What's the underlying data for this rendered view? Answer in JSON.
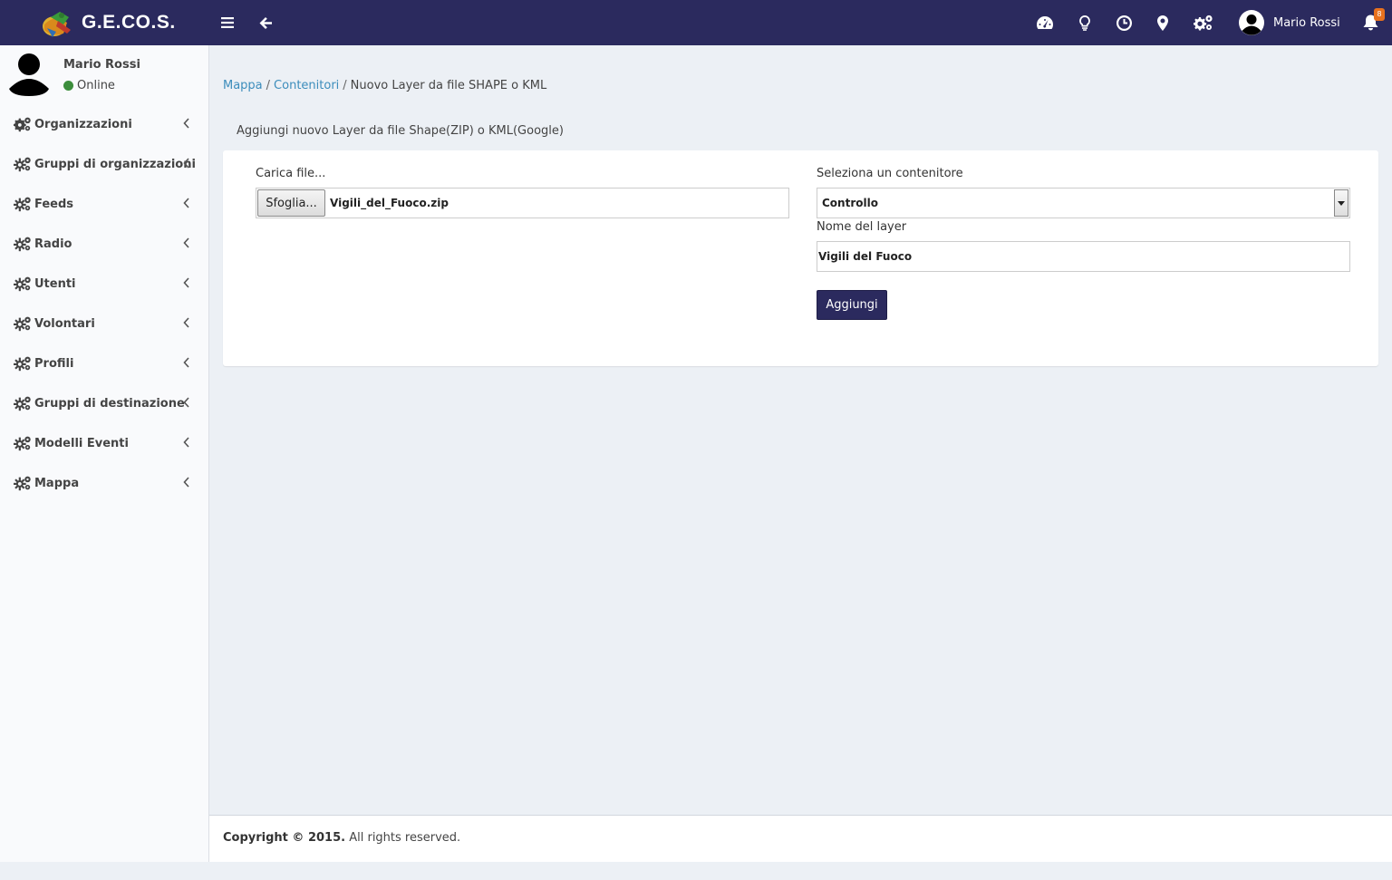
{
  "header": {
    "brand": "G.E.CO.S.",
    "user_name": "Mario Rossi",
    "notification_count": "8",
    "icons": [
      "menu-toggle-icon",
      "back-arrow-icon",
      "dashboard-icon",
      "lightbulb-icon",
      "clock-icon",
      "map-marker-icon",
      "cogs-icon",
      "user-avatar-icon",
      "bell-icon"
    ]
  },
  "sidebar": {
    "user_name": "Mario Rossi",
    "status": "Online",
    "status_color": "#3c8d3c",
    "items": [
      {
        "label": "Organizzazioni"
      },
      {
        "label": "Gruppi di organizzazioni"
      },
      {
        "label": "Feeds"
      },
      {
        "label": "Radio"
      },
      {
        "label": "Utenti"
      },
      {
        "label": "Volontari"
      },
      {
        "label": "Profili"
      },
      {
        "label": "Gruppi di destinazione"
      },
      {
        "label": "Modelli Eventi"
      },
      {
        "label": "Mappa"
      }
    ]
  },
  "breadcrumb": {
    "items": [
      "Mappa",
      "Contenitori"
    ],
    "current": "Nuovo Layer da file SHAPE o KML",
    "separator": "/"
  },
  "form": {
    "title": "Aggiungi nuovo Layer da file Shape(ZIP) o KML(Google)",
    "file_label": "Carica file...",
    "file_button": "Sfoglia...",
    "file_value": "Vigili_del_Fuoco.zip",
    "container_label": "Seleziona un contenitore",
    "container_value": "Controllo",
    "layer_name_label": "Nome del layer",
    "layer_name_value": "Vigili del Fuoco",
    "submit_label": "Aggiungi"
  },
  "footer": {
    "copyright": "Copyright © 2015.",
    "rights": "All rights reserved."
  },
  "colors": {
    "header_bg": "#2b2a5e",
    "link": "#3c8dbc",
    "badge": "#e8711e",
    "page_bg": "#ecf0f5"
  }
}
